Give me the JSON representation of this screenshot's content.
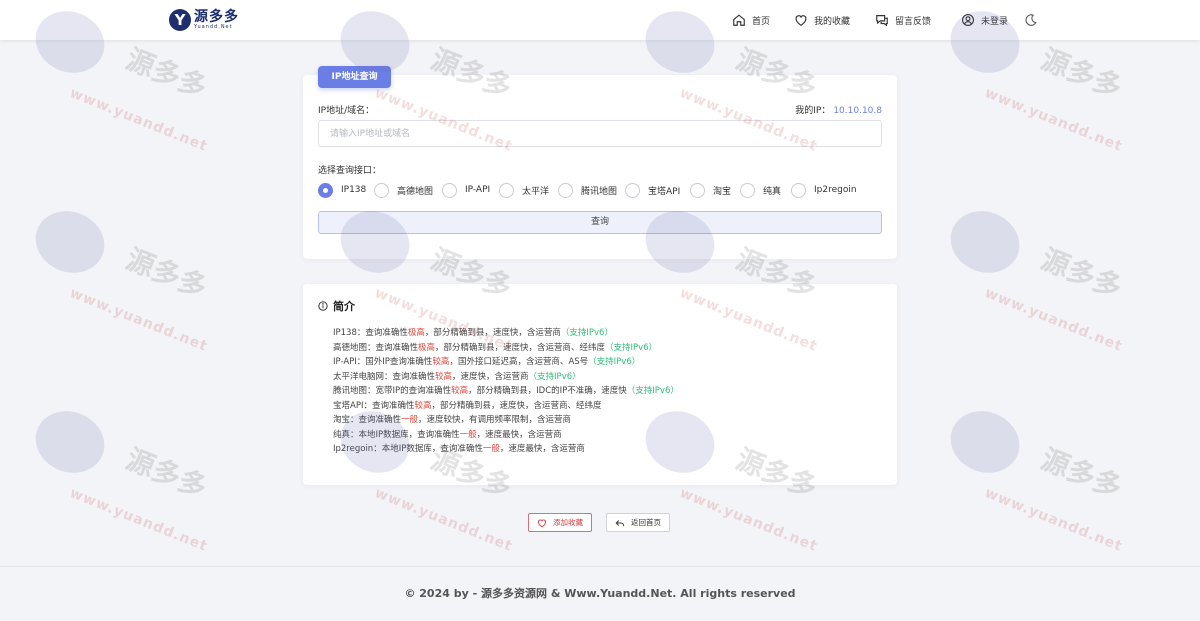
{
  "header": {
    "logo_cn": "源多多",
    "logo_en": "Yuandd.Net",
    "nav": [
      {
        "label": "首页",
        "icon": "home-icon"
      },
      {
        "label": "我的收藏",
        "icon": "heart-icon"
      },
      {
        "label": "留言反馈",
        "icon": "message-icon"
      },
      {
        "label": "未登录",
        "icon": "user-icon"
      }
    ],
    "theme_icon": "moon-icon"
  },
  "query": {
    "tab_label": "IP地址查询",
    "ip_label": "IP地址/域名：",
    "my_ip_label": "我的IP：",
    "my_ip_value": "10.10.10.8",
    "input_placeholder": "请输入IP地址或域名",
    "api_label": "选择查询接口：",
    "apis": [
      {
        "label": "IP138",
        "checked": true
      },
      {
        "label": "高德地图",
        "checked": false
      },
      {
        "label": "IP-API",
        "checked": false
      },
      {
        "label": "太平洋",
        "checked": false
      },
      {
        "label": "腾讯地图",
        "checked": false
      },
      {
        "label": "宝塔API",
        "checked": false
      },
      {
        "label": "淘宝",
        "checked": false
      },
      {
        "label": "纯真",
        "checked": false
      },
      {
        "label": "Ip2regoin",
        "checked": false
      }
    ],
    "button_label": "查询"
  },
  "intro": {
    "title": "简介",
    "lines": [
      {
        "pre": "IP138：查询准确性",
        "hl": "极高",
        "post": "，部分精确到县，速度快，含运营商",
        "ipv6": "（支持IPv6）"
      },
      {
        "pre": "高德地图：查询准确性",
        "hl": "极高",
        "post": "，部分精确到县，速度快，含运营商、经纬度",
        "ipv6": "（支持IPv6）"
      },
      {
        "pre": "IP-API：国外IP查询准确性",
        "hl": "较高",
        "post": "，国外接口延迟高，含运营商、AS号",
        "ipv6": "（支持IPv6）"
      },
      {
        "pre": "太平洋电脑网：查询准确性",
        "hl": "较高",
        "post": "，速度快，含运营商",
        "ipv6": "（支持IPv6）"
      },
      {
        "pre": "腾讯地图：宽带IP的查询准确性",
        "hl": "较高",
        "post": "，部分精确到县，IDC的IP不准确，速度快",
        "ipv6": "（支持IPv6）"
      },
      {
        "pre": "宝塔API：查询准确性",
        "hl": "较高",
        "post": "，部分精确到县，速度快，含运营商、经纬度",
        "ipv6": ""
      },
      {
        "pre": "淘宝：查询准确性",
        "hl": "一般",
        "post": "，速度较快，有调用频率限制，含运营商",
        "ipv6": ""
      },
      {
        "pre": "纯真：本地IP数据库，查询准确性",
        "hl": "一般",
        "post": "，速度最快，含运营商",
        "ipv6": ""
      },
      {
        "pre": "Ip2regoin：本地IP数据库，查询准确性",
        "hl": "一般",
        "post": "，速度最快，含运营商",
        "ipv6": ""
      }
    ]
  },
  "actions": {
    "favorite_label": "添加收藏",
    "home_label": "返回首页"
  },
  "footer": {
    "text": "© 2024 by - 源多多资源网 & Www.Yuandd.Net. All rights reserved"
  },
  "watermark": {
    "cn": "源多多",
    "url": "www.yuandd.net"
  },
  "colors": {
    "accent": "#6a7ee6",
    "highlight": "#e0473b",
    "ipv6": "#2dbd7a",
    "brand": "#1d2f6f"
  }
}
